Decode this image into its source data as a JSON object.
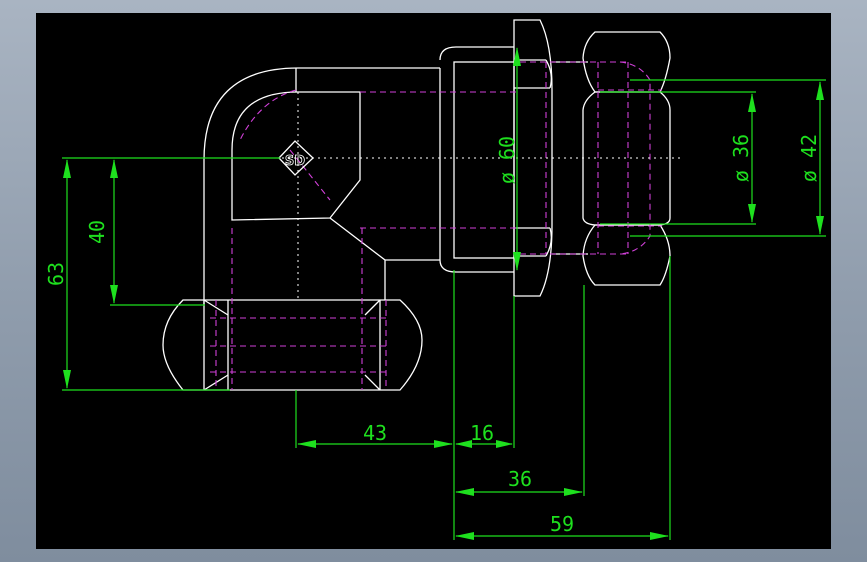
{
  "drawing": {
    "colors": {
      "background": "#000000",
      "outline": "#ffffff",
      "hidden_lines": "#d040d8",
      "dimensions": "#1ee01e",
      "frame_gradient_top": "#a9b4c2",
      "frame_gradient_bottom": "#7f8d9e"
    },
    "logo_text": "SD",
    "dimensions": {
      "height_total": "63",
      "height_center": "40",
      "horizontal_center": "43",
      "nut_width": "16",
      "nut_offset": "36",
      "overall_length": "59",
      "dia_nut": "ø 60",
      "dia_bore": "ø 36",
      "dia_outer": "ø 42"
    }
  }
}
